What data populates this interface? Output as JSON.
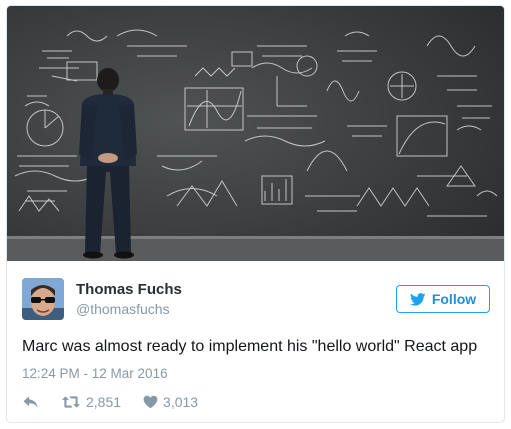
{
  "tweet": {
    "author": {
      "name": "Thomas Fuchs",
      "handle": "@thomasfuchs"
    },
    "follow_label": "Follow",
    "text": "Marc was almost ready to implement his \"hello world\" React app",
    "timestamp": "12:24 PM - 12 Mar 2016",
    "retweets": "2,851",
    "likes": "3,013"
  },
  "icons": {
    "reply": "reply-icon",
    "retweet": "retweet-icon",
    "like": "heart-icon",
    "follow": "twitter-bird-icon"
  },
  "colors": {
    "accent": "#1da1f2",
    "muted": "#8899a6",
    "text": "#14171a",
    "chalkboard": "#3c3e3f"
  }
}
